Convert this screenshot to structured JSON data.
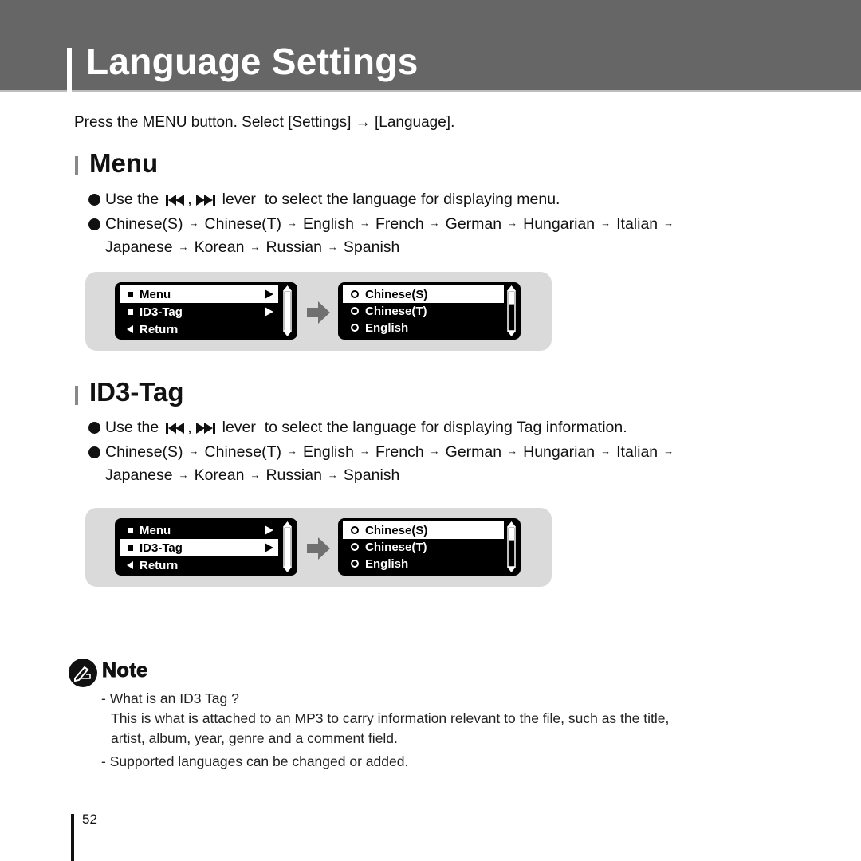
{
  "header": {
    "title": "Language Settings"
  },
  "intro": {
    "text": "Press the MENU button. Select [Settings] → [Language]."
  },
  "sections": [
    {
      "title": "Menu",
      "use_prefix": "Use the",
      "use_suffix": "lever  to select the language for displaying menu.",
      "lever_icons": [
        "skip-back-icon",
        "skip-forward-icon"
      ],
      "languages_line1": [
        "Chinese(S)",
        "Chinese(T)",
        "English",
        "French",
        "German",
        "Hungarian",
        "Italian"
      ],
      "languages_line2": [
        "Japanese",
        "Korean",
        "Russian",
        "Spanish"
      ],
      "screen_left": {
        "rows": [
          {
            "label": "Menu",
            "icon": "square-bullet-icon",
            "chevron": true,
            "selected": true
          },
          {
            "label": "ID3-Tag",
            "icon": "square-bullet-icon",
            "chevron": true,
            "selected": false
          },
          {
            "label": "Return",
            "icon": "back-triangle-icon",
            "chevron": false,
            "selected": false
          }
        ],
        "scroll_fraction": 1.0
      },
      "screen_right": {
        "rows": [
          {
            "label": "Chinese(S)",
            "icon": "radio-ring-icon",
            "selected": true
          },
          {
            "label": "Chinese(T)",
            "icon": "radio-ring-icon",
            "selected": false
          },
          {
            "label": "English",
            "icon": "radio-ring-icon",
            "selected": false
          }
        ],
        "scroll_fraction": 0.3
      }
    },
    {
      "title": "ID3-Tag",
      "use_prefix": "Use the",
      "use_suffix": "lever  to select the language for displaying Tag information.",
      "lever_icons": [
        "skip-back-icon",
        "skip-forward-icon"
      ],
      "languages_line1": [
        "Chinese(S)",
        "Chinese(T)",
        "English",
        "French",
        "German",
        "Hungarian",
        "Italian"
      ],
      "languages_line2": [
        "Japanese",
        "Korean",
        "Russian",
        "Spanish"
      ],
      "screen_left": {
        "rows": [
          {
            "label": "Menu",
            "icon": "square-bullet-icon",
            "chevron": true,
            "selected": false
          },
          {
            "label": "ID3-Tag",
            "icon": "square-bullet-icon",
            "chevron": true,
            "selected": true
          },
          {
            "label": "Return",
            "icon": "back-triangle-icon",
            "chevron": false,
            "selected": false
          }
        ],
        "scroll_fraction": 1.0
      },
      "screen_right": {
        "rows": [
          {
            "label": "Chinese(S)",
            "icon": "radio-ring-icon",
            "selected": true
          },
          {
            "label": "Chinese(T)",
            "icon": "radio-ring-icon",
            "selected": false
          },
          {
            "label": "English",
            "icon": "radio-ring-icon",
            "selected": false
          }
        ],
        "scroll_fraction": 0.3
      }
    }
  ],
  "arrow_glyph": "→",
  "note": {
    "title": "Note",
    "items": [
      "- What is an ID3 Tag ?",
      "This is what is attached to an MP3 to carry information relevant to the file, such as the title,",
      "artist, album, year, genre and a comment field.",
      "- Supported languages can be changed or added."
    ]
  },
  "page_number": "52",
  "colors": {
    "header_band": "#666666",
    "figure_bg": "#dadada",
    "lcd_bg": "#000000",
    "arrow_gray": "#707070"
  }
}
